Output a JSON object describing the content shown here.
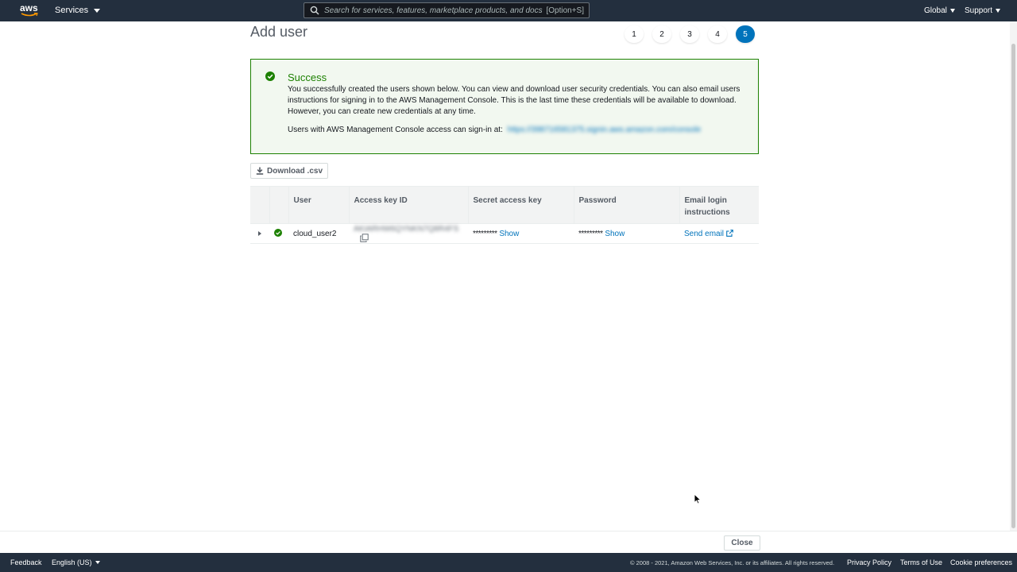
{
  "nav": {
    "logo_text": "aws",
    "services_label": "Services",
    "search_placeholder": "Search for services, features, marketplace products, and docs",
    "search_shortcut": "[Option+S]",
    "region_label": "Global",
    "support_label": "Support"
  },
  "page": {
    "title": "Add user",
    "steps": [
      "1",
      "2",
      "3",
      "4",
      "5"
    ],
    "active_step": "5"
  },
  "alert": {
    "heading": "Success",
    "body": "You successfully created the users shown below. You can view and download user security credentials. You can also email users instructions for signing in to the AWS Management Console. This is the last time these credentials will be available to download. However, you can create new credentials at any time.",
    "signin_label": "Users with AWS Management Console access can sign-in at:",
    "signin_url_blurred": "https://398716581375.signin.aws.amazon.com/console"
  },
  "toolbar": {
    "download_label": "Download .csv"
  },
  "table": {
    "headers": {
      "user": "User",
      "access_key": "Access key ID",
      "secret_key": "Secret access key",
      "password": "Password",
      "email": "Email login instructions"
    },
    "rows": [
      {
        "user": "cloud_user2",
        "access_key_blurred": "AKIARHW6QYNKN7Q8R4FS",
        "secret_masked": "*********",
        "secret_action": "Show",
        "password_masked": "*********",
        "password_action": "Show",
        "email_action": "Send email"
      }
    ]
  },
  "bottom": {
    "close_label": "Close"
  },
  "footer": {
    "feedback": "Feedback",
    "language": "English (US)",
    "copyright": "© 2008 - 2021, Amazon Web Services, Inc. or its affiliates. All rights reserved.",
    "privacy": "Privacy Policy",
    "terms": "Terms of Use",
    "cookies": "Cookie preferences"
  },
  "colors": {
    "nav_bg": "#232f3e",
    "success_green": "#1d8102",
    "link_blue": "#0073bb",
    "active_step": "#0073bb"
  }
}
